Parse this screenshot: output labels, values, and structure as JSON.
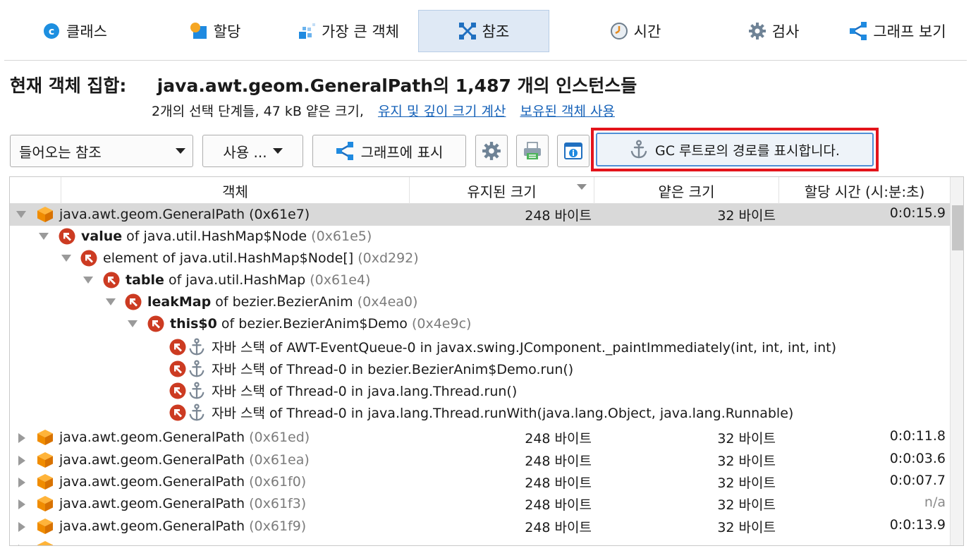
{
  "tabs": [
    {
      "label": "클래스",
      "icon": "class-icon"
    },
    {
      "label": "할당",
      "icon": "allocation-icon"
    },
    {
      "label": "가장 큰 객체",
      "icon": "biggest-objects-icon"
    },
    {
      "label": "참조",
      "icon": "references-icon"
    },
    {
      "label": "시간",
      "icon": "clock-icon"
    },
    {
      "label": "검사",
      "icon": "gear-icon"
    },
    {
      "label": "그래프 보기",
      "icon": "graph-icon"
    }
  ],
  "active_tab": "참조",
  "heading": {
    "label": "현재 객체 집합:",
    "value": "java.awt.geom.GeneralPath의 1,487 개의 인스턴스들"
  },
  "subline": {
    "text": "2개의 선택 단계들, 47 kB 얕은 크기,",
    "link1": "유지 및 깊이 크기 계산",
    "link2": "보유된 객체 사용"
  },
  "toolbar": {
    "combo_value": "들어오는 참조",
    "use_label": "사용 ...",
    "graph_label": "그래프에 표시",
    "gc_label": "GC 루트로의 경로를 표시합니다."
  },
  "columns": {
    "object": "객체",
    "retained": "유지된 크기",
    "shallow": "얕은 크기",
    "alloc_time": "할당 시간 (시:분:초)"
  },
  "rows": [
    {
      "text": "java.awt.geom.GeneralPath",
      "hex": "(0x61e7)",
      "retained": "248 바이트",
      "shallow": "32 바이트",
      "time": "0:0:15.9"
    },
    {
      "bold": "value",
      "text": " of java.util.HashMap$Node",
      "hex": "(0x61e5)"
    },
    {
      "text": "element of java.util.HashMap$Node[]",
      "hex": "(0xd292)"
    },
    {
      "bold": "table",
      "text": " of java.util.HashMap",
      "hex": "(0x61e4)"
    },
    {
      "bold": "leakMap",
      "text": " of bezier.BezierAnim",
      "hex": "(0x4ea0)"
    },
    {
      "bold": "this$0",
      "text": " of bezier.BezierAnim$Demo",
      "hex": "(0x4e9c)"
    },
    {
      "text": "자바 스택 of AWT-EventQueue-0 in javax.swing.JComponent._paintImmediately(int, int, int, int)"
    },
    {
      "text": "자바 스택 of Thread-0 in bezier.BezierAnim$Demo.run()"
    },
    {
      "text": "자바 스택 of Thread-0 in java.lang.Thread.run()"
    },
    {
      "text": "자바 스택 of Thread-0 in java.lang.Thread.runWith(java.lang.Object, java.lang.Runnable)"
    },
    {
      "text": "java.awt.geom.GeneralPath",
      "hex": "(0x61ed)",
      "retained": "248 바이트",
      "shallow": "32 바이트",
      "time": "0:0:11.8"
    },
    {
      "text": "java.awt.geom.GeneralPath",
      "hex": "(0x61ea)",
      "retained": "248 바이트",
      "shallow": "32 바이트",
      "time": "0:0:03.6"
    },
    {
      "text": "java.awt.geom.GeneralPath",
      "hex": "(0x61f0)",
      "retained": "248 바이트",
      "shallow": "32 바이트",
      "time": "0:0:07.7"
    },
    {
      "text": "java.awt.geom.GeneralPath",
      "hex": "(0x61f3)",
      "retained": "248 바이트",
      "shallow": "32 바이트",
      "time": "n/a"
    },
    {
      "text": "java.awt.geom.GeneralPath",
      "hex": "(0x61f9)",
      "retained": "248 바이트",
      "shallow": "32 바이트",
      "time": "0:0:13.9"
    }
  ]
}
